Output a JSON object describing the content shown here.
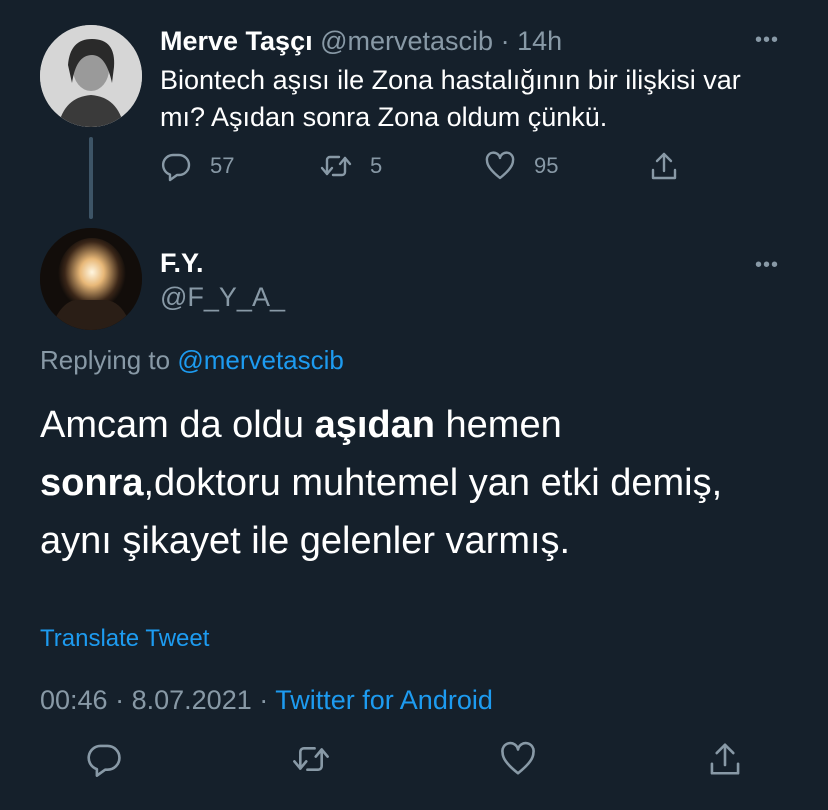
{
  "tweet1": {
    "name": "Merve Taşçı",
    "handle": "@mervetascib",
    "separator": "·",
    "time": "14h",
    "text": "Biontech aşısı ile Zona hastalığının bir ilişkisi var mı? Aşıdan sonra Zona oldum çünkü.",
    "replies": "57",
    "retweets": "5",
    "likes": "95"
  },
  "tweet2": {
    "name": "F.Y.",
    "handle": "@F_Y_A_",
    "replying_prefix": "Replying to",
    "replying_to": "@mervetascib",
    "body": {
      "p1": "Amcam da oldu ",
      "b1": "aşıdan",
      "p2": " hemen ",
      "b2": "sonra",
      "p3": ",doktoru muhtemel yan etki demiş, aynı şikayet ile gelenler varmış."
    },
    "translate": "Translate Tweet",
    "time": "00:46",
    "date": "8.07.2021",
    "separator": "·",
    "source": "Twitter for Android"
  },
  "icons": {
    "more": "more-icon",
    "reply": "reply-icon",
    "retweet": "retweet-icon",
    "like": "heart-icon",
    "share": "share-icon"
  },
  "colors": {
    "background": "#15202b",
    "muted": "#8899a6",
    "link": "#1d9bf0",
    "thread_line": "#3d5466"
  }
}
